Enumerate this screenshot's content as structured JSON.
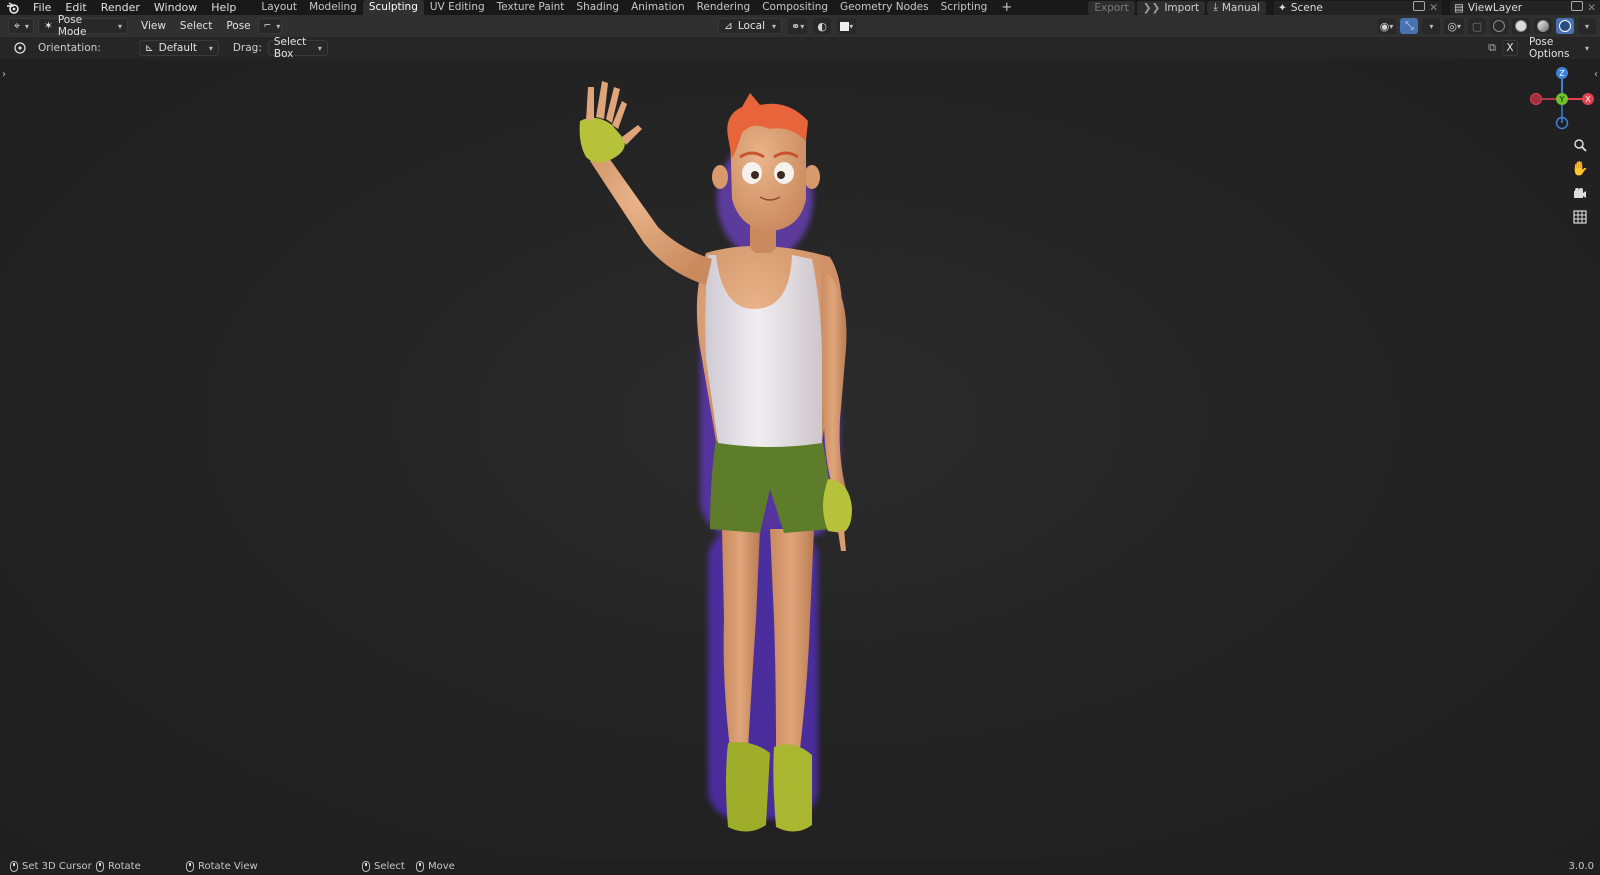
{
  "topbar": {
    "menus": [
      "File",
      "Edit",
      "Render",
      "Window",
      "Help"
    ],
    "workspaces": [
      "Layout",
      "Modeling",
      "Sculpting",
      "UV Editing",
      "Texture Paint",
      "Shading",
      "Animation",
      "Rendering",
      "Compositing",
      "Geometry Nodes",
      "Scripting"
    ],
    "active_workspace": "Sculpting",
    "add_tab": "+",
    "export_label": "Export",
    "import_label": "Import",
    "manual_label": "Manual",
    "scene": "Scene",
    "view_layer": "ViewLayer"
  },
  "header": {
    "mode": "Pose Mode",
    "menus": [
      "View",
      "Select",
      "Pose"
    ],
    "transform_orientation": "Local"
  },
  "tool_settings": {
    "orientation_label": "Orientation:",
    "orientation_value": "Default",
    "drag_label": "Drag:",
    "drag_value": "Select Box",
    "pose_options": "Pose Options",
    "mirror_x": "X"
  },
  "gizmo": {
    "z": "Z",
    "y": "Y",
    "x": "X"
  },
  "statusbar": {
    "set_cursor": "Set 3D Cursor",
    "rotate": "Rotate",
    "rotate_view": "Rotate View",
    "select": "Select",
    "move": "Move",
    "version": "3.0.0"
  },
  "colors": {
    "accent": "#4772b3",
    "axis_x": "#e0404f",
    "axis_y": "#6fc22a",
    "axis_z": "#3b82d8",
    "skin": "#d9a070",
    "shirt": "#e8e4e6",
    "shorts": "#5e7d2a",
    "gloves": "#b6c23a",
    "hair": "#e8643a"
  },
  "icons": [
    "blender-logo-icon",
    "editor-type-icon",
    "pose-mode-icon",
    "orientation-icon",
    "drag-cursor-icon",
    "overlay-icon",
    "gizmo-icon",
    "zoom-icon",
    "pan-hand-icon",
    "camera-icon",
    "grid-icon",
    "mouse-left-icon",
    "mouse-right-icon",
    "mouse-middle-icon"
  ]
}
